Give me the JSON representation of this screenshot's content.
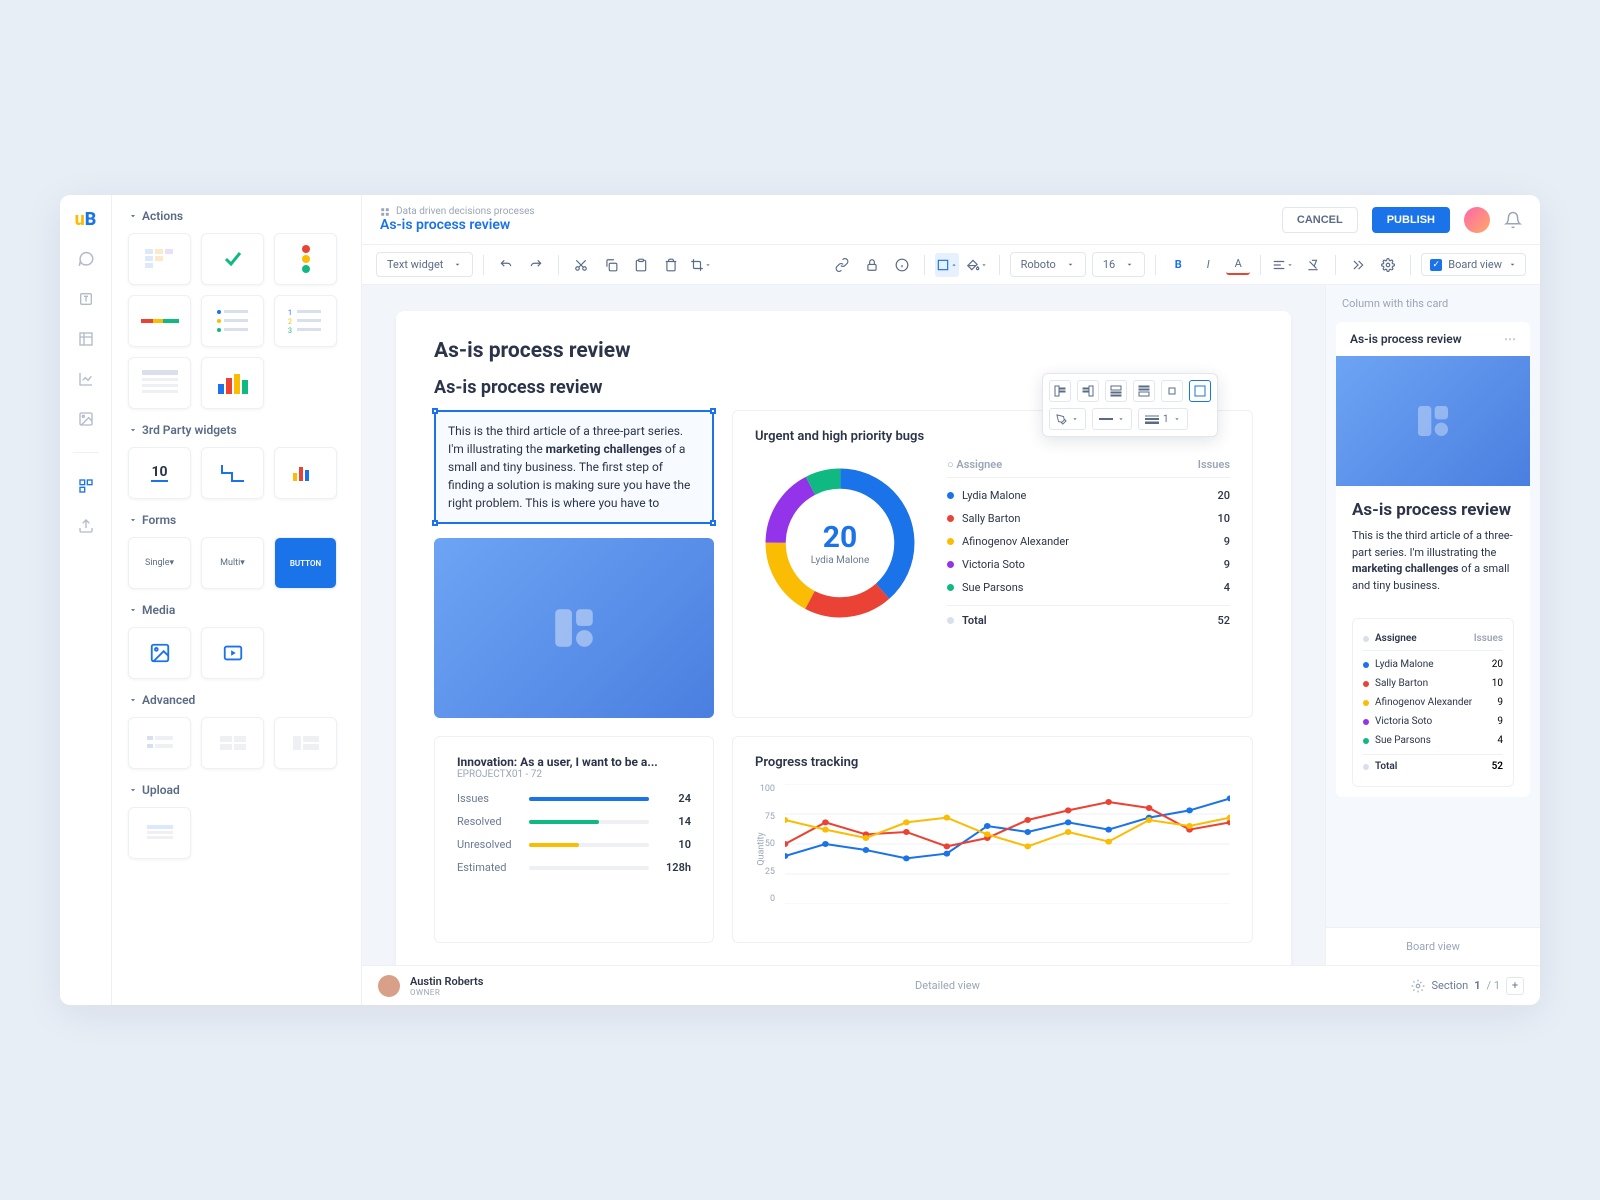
{
  "header": {
    "breadcrumb": "Data driven decisions proceses",
    "title": "As-is process review",
    "cancel": "CANCEL",
    "publish": "PUBLISH",
    "board_view": "Board view"
  },
  "toolbar": {
    "widget_type": "Text widget",
    "font": "Roboto",
    "size": "16",
    "line_label": "1"
  },
  "panel": {
    "actions": "Actions",
    "third_party": "3rd Party widgets",
    "forms": "Forms",
    "media": "Media",
    "advanced": "Advanced",
    "upload": "Upload",
    "form_single": "Single",
    "form_multi": "Multi",
    "form_button": "BUTTON",
    "cal_day": "10"
  },
  "doc": {
    "title": "As-is process review",
    "subtitle": "As-is process review",
    "text_before": "This is the third article of a three-part series. I'm illustrating the ",
    "text_bold": "marketing challenges",
    "text_after": " of a small and tiny business. The first step of finding a solution is making sure you have the right problem. This is where you have to"
  },
  "chart_data": {
    "donut": {
      "type": "pie",
      "title": "Urgent and high priority bugs",
      "center_value": 20,
      "center_label": "Lydia Malone",
      "legend_hd_a": "Assignee",
      "legend_hd_b": "Issues",
      "series": [
        {
          "name": "Lydia Malone",
          "value": 20,
          "color": "#1a73e8"
        },
        {
          "name": "Sally Barton",
          "value": 10,
          "color": "#ea4335"
        },
        {
          "name": "Afinogenov Alexander",
          "value": 9,
          "color": "#fbbc04"
        },
        {
          "name": "Victoria Soto",
          "value": 9,
          "color": "#9333ea"
        },
        {
          "name": "Sue Parsons",
          "value": 4,
          "color": "#10b981"
        }
      ],
      "total_label": "Total",
      "total": 52
    },
    "stats": {
      "title": "Innovation: As a user, I want to be a...",
      "sub": "EPROJECTX01 - 72",
      "rows": [
        {
          "label": "Issues",
          "value": "24",
          "pct": 100,
          "color": "#1a73e8"
        },
        {
          "label": "Resolved",
          "value": "14",
          "pct": 58,
          "color": "#10b981"
        },
        {
          "label": "Unresolved",
          "value": "10",
          "pct": 42,
          "color": "#fbbc04"
        },
        {
          "label": "Estimated",
          "value": "128h",
          "pct": 0,
          "color": "#1a73e8"
        }
      ]
    },
    "line": {
      "type": "line",
      "title": "Progress tracking",
      "ylabel": "Quantity",
      "ylim": [
        0,
        100
      ],
      "yticks": [
        0,
        25,
        50,
        75,
        100
      ],
      "x": [
        1,
        2,
        3,
        4,
        5,
        6,
        7,
        8,
        9,
        10,
        11,
        12
      ],
      "series": [
        {
          "name": "blue",
          "color": "#1a73e8",
          "values": [
            40,
            50,
            45,
            38,
            42,
            65,
            60,
            68,
            62,
            72,
            78,
            88
          ]
        },
        {
          "name": "red",
          "color": "#ea4335",
          "values": [
            50,
            68,
            58,
            60,
            48,
            55,
            70,
            78,
            85,
            80,
            62,
            68
          ]
        },
        {
          "name": "yellow",
          "color": "#fbbc04",
          "values": [
            70,
            62,
            55,
            68,
            72,
            58,
            48,
            60,
            52,
            70,
            65,
            72
          ]
        }
      ]
    }
  },
  "footer": {
    "author": "Austin Roberts",
    "role": "OWNER",
    "tab": "Detailed view",
    "section_label": "Section",
    "section_cur": "1",
    "section_total": "/ 1"
  },
  "right": {
    "col_title": "Column with tihs card",
    "card_title": "As-is process review",
    "heading": "As-is process review",
    "text_before": "This is the third article of a three-part series. I'm illustrating the ",
    "text_bold": "marketing challenges",
    "text_after": " of a small and tiny business.",
    "footer": "Board view"
  }
}
